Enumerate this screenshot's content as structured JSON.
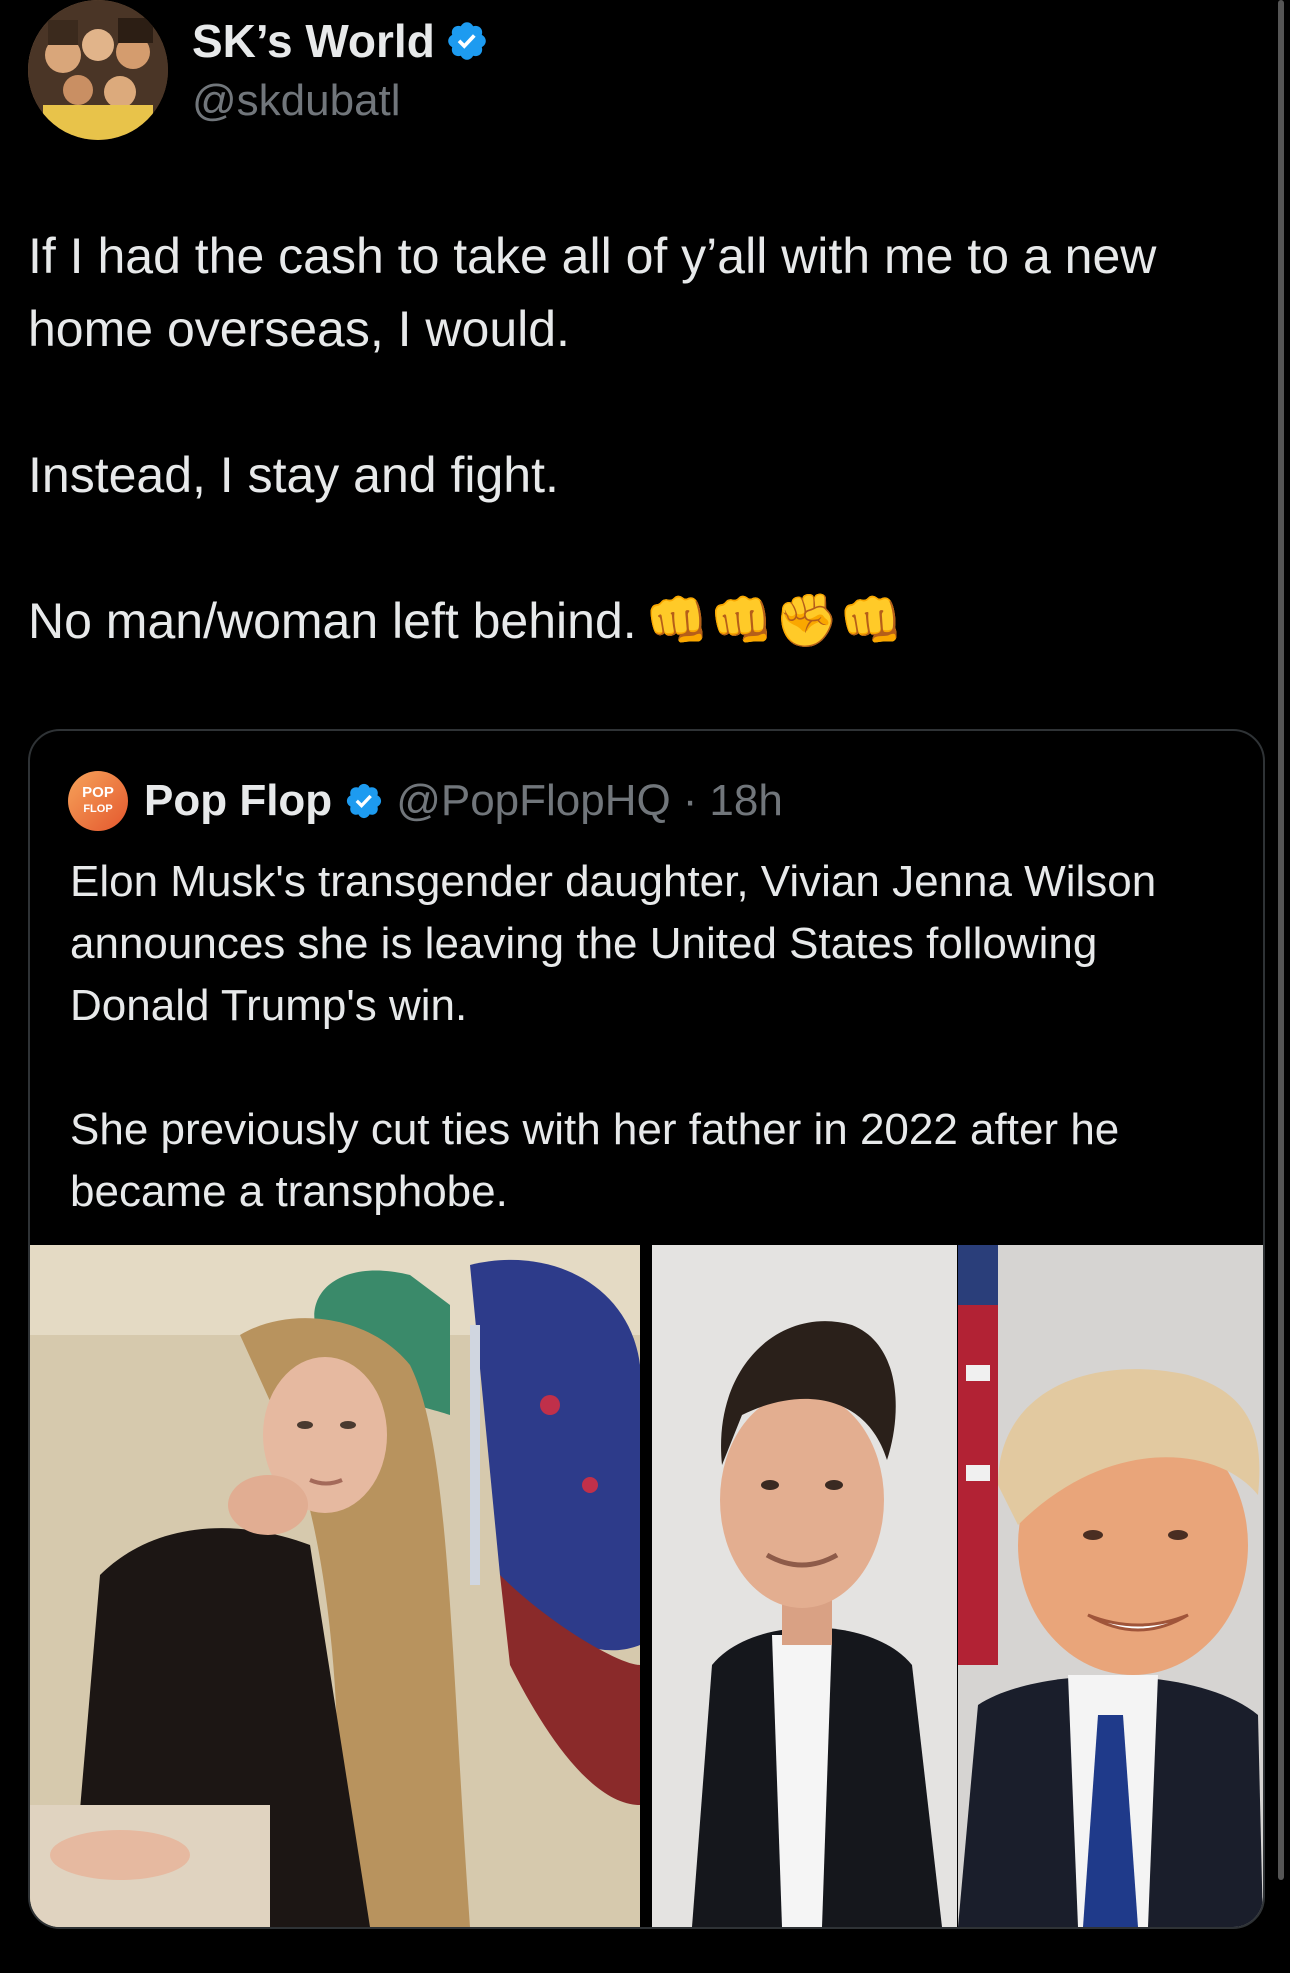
{
  "author": {
    "display_name": "SK’s World",
    "handle": "@skdubatl",
    "verified_color": "#1d9bf0"
  },
  "tweet": {
    "paragraphs": [
      "If I had the cash to take all of y’all with me to a new home overseas, I would.",
      "Instead, I stay and fight.",
      "No man/woman left behind."
    ],
    "emojis": "👊👊✊👊"
  },
  "quoted": {
    "avatar_line1": "POP",
    "avatar_line2": "FLOP",
    "display_name": "Pop Flop",
    "handle": "@PopFlopHQ",
    "separator": "·",
    "time": "18h",
    "paragraphs": [
      "Elon Musk's transgender daughter, Vivian Jenna Wilson announces she is leaving the United States following Donald Trump's win.",
      "She previously cut ties with her father in 2022 after he became a transphobe."
    ]
  },
  "colors": {
    "background": "#000000",
    "text": "#e7e9ea",
    "muted": "#71767b",
    "border": "#2f3336",
    "accent": "#1d9bf0"
  }
}
